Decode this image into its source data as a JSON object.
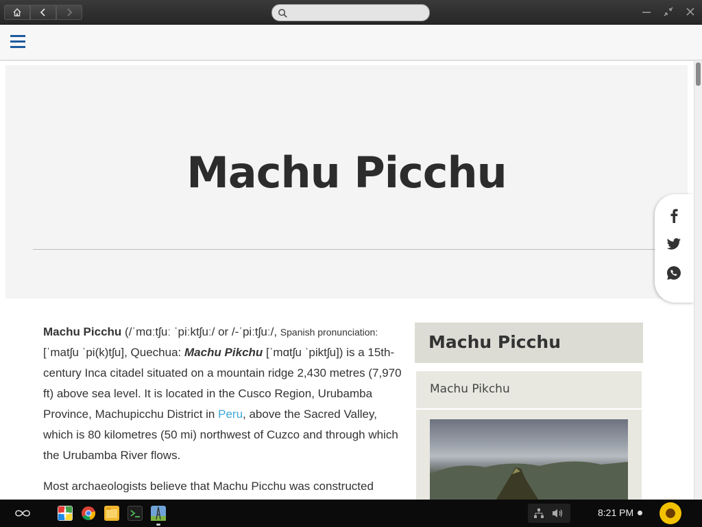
{
  "browser": {
    "search_placeholder": ""
  },
  "article": {
    "title": "Machu Picchu",
    "p1": {
      "name": "Machu Picchu",
      "ipa1": "(/ˈmɑːtʃuː ˈpiːktʃuː/",
      "or": " or ",
      "ipa2": "/-ˈpiːtʃuː/,",
      "spanish": "Spanish pronunciation:",
      "spanish_ipa": "[ˈmatʃu ˈpi(k)tʃu],",
      "quechua_label": "Quechua:",
      "quechua_name": "Machu Pikchu",
      "quechua_ipa": "[ˈmɑtʃu ˈpiktʃu])",
      "text1": "is a 15th-century Inca citadel situated on a mountain ridge 2,430 metres (7,970 ft) above sea level. It is located in the Cusco Region, Urubamba Province, Machupicchu District in",
      "link": "Peru",
      "text2": ", above the Sacred Valley, which is 80 kilometres (50 mi) northwest of Cuzco and through which the Urubamba River flows."
    },
    "p2": "Most archaeologists believe that Machu Picchu was constructed"
  },
  "infobox": {
    "title": "Machu Picchu",
    "subtitle": "Machu Pikchu"
  },
  "taskbar": {
    "clock": "8:21 PM"
  },
  "colors": {
    "link": "#3aa7d8",
    "hamburger": "#1e5a9e"
  }
}
